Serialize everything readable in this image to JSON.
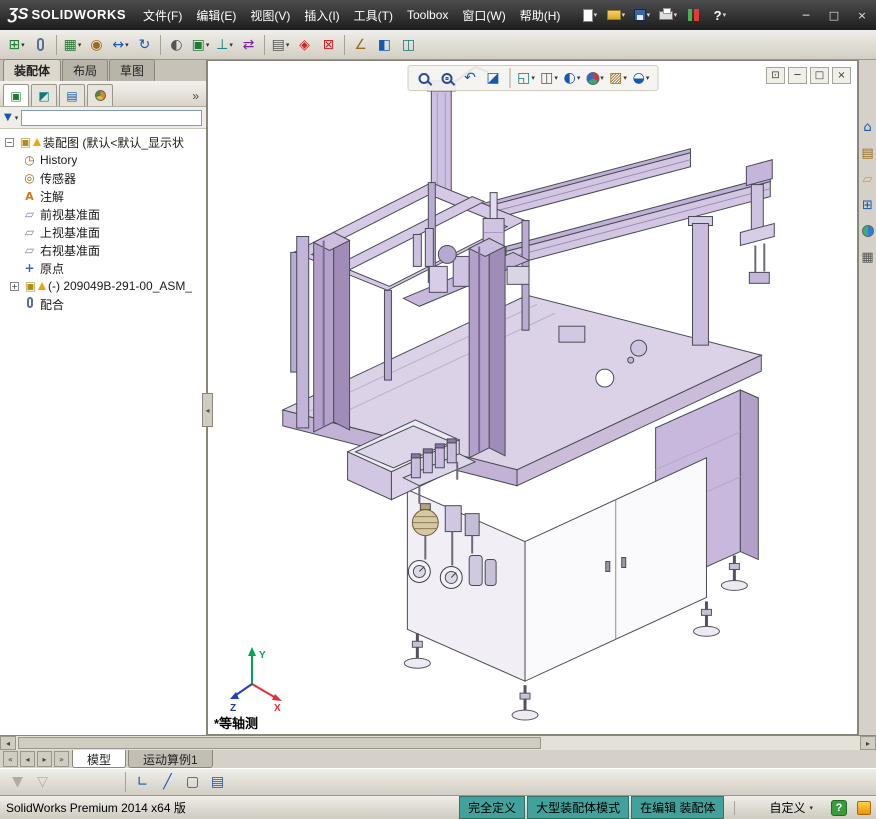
{
  "titlebar": {
    "logo_prefix": "ƷS",
    "logo_text": "SOLIDWORKS",
    "menus": [
      "文件(F)",
      "编辑(E)",
      "视图(V)",
      "插入(I)",
      "工具(T)",
      "Toolbox",
      "窗口(W)",
      "帮助(H)"
    ],
    "window": {
      "minimize": "─",
      "maximize": "□",
      "close": "×"
    }
  },
  "icons": {
    "caret": "▾",
    "chevrons": "»",
    "help_q": "?",
    "insert_component": "⊞",
    "linear_pattern": "▦",
    "smart_fasteners": "◉",
    "move_component": "↔",
    "rotate_component": "↻",
    "show_hidden": "◐",
    "assembly_features": "▣",
    "reference_geometry": "⊥",
    "motion_study": "⇄",
    "bom": "▤",
    "exploded_view": "◈",
    "interference": "⊠",
    "measure": "∠",
    "section": "◧",
    "large_assembly": "◫",
    "previous_view": "↶",
    "section_view": "◪",
    "view_orientation": "◱",
    "display_style": "◫",
    "hide_items": "◐",
    "scene": "▨",
    "view_settings": "◒",
    "mdi_restore": "⊡",
    "mdi_min": "─",
    "mdi_max": "□",
    "mdi_close": "×",
    "home": "⌂",
    "design_library": "▤",
    "file_explorer": "▱",
    "view_palette": "⊞",
    "custom_properties": "▦",
    "fm_tab": "▣",
    "pm_tab": "◩",
    "cfg_tab": "▤",
    "filter_funnel": "▼",
    "tree_assembly": "▣",
    "tree_history": "◷",
    "tree_sensors": "◎",
    "tree_annotations": "A",
    "tree_plane": "▱",
    "tree_origin": "+",
    "minus": "−",
    "plus": "+",
    "scroll_left": "◂",
    "scroll_right": "▸",
    "filter_clear": "▼",
    "filter_toggle": "▽",
    "filter_vertices": "∟",
    "filter_edges": "╱",
    "filter_faces": "▢",
    "filter_surface": "▤"
  },
  "command_tabs": [
    {
      "label": "装配体"
    },
    {
      "label": "布局"
    },
    {
      "label": "草图"
    }
  ],
  "tree": {
    "items": [
      {
        "label": "装配图 (默认<默认_显示状"
      },
      {
        "label": "History"
      },
      {
        "label": "传感器"
      },
      {
        "label": "注解"
      },
      {
        "label": "前视基准面"
      },
      {
        "label": "上视基准面"
      },
      {
        "label": "右视基准面"
      },
      {
        "label": "原点"
      },
      {
        "label": "(-) 209049B-291-00_ASM_"
      },
      {
        "label": "配合"
      }
    ]
  },
  "viewport": {
    "view_label": "*等轴测"
  },
  "model_tabs": {
    "nav": [
      "«",
      "◂",
      "▸",
      "»"
    ],
    "tabs": [
      {
        "label": "模型"
      },
      {
        "label": "运动算例1"
      }
    ]
  },
  "statusbar": {
    "left_text": "SolidWorks Premium 2014 x64 版",
    "segments": [
      "完全定义",
      "大型装配体模式",
      "在编辑 装配体"
    ],
    "custom_label": "自定义"
  }
}
